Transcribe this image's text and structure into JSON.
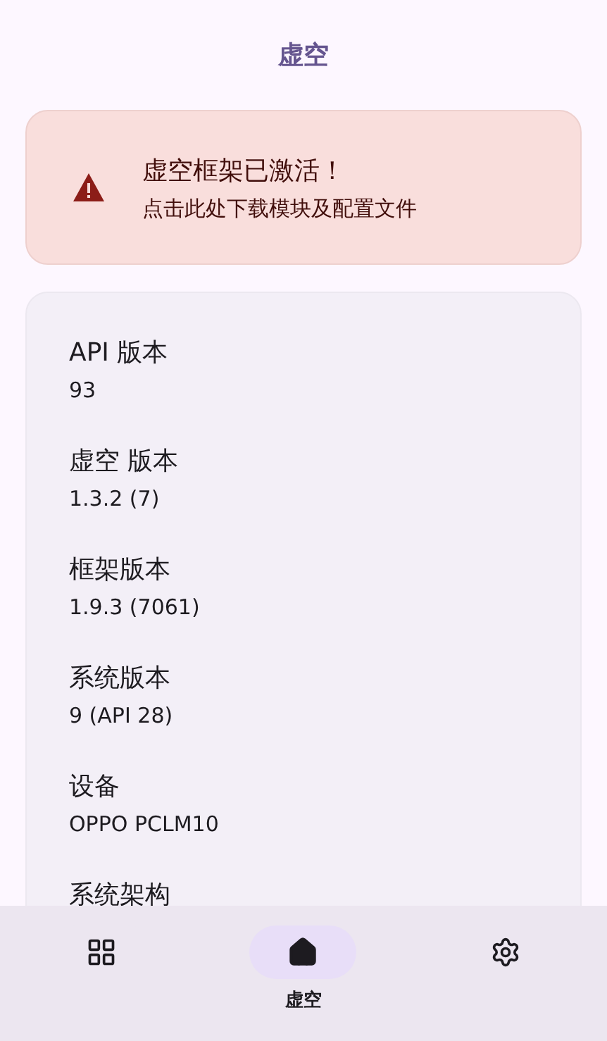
{
  "app_bar": {
    "title": "虚空"
  },
  "status_card": {
    "title": "虚空框架已激活！",
    "subtitle": "点击此处下载模块及配置文件"
  },
  "info": [
    {
      "label": "API 版本",
      "value": "93"
    },
    {
      "label": "虚空 版本",
      "value": "1.3.2 (7)"
    },
    {
      "label": "框架版本",
      "value": "1.9.3 (7061)"
    },
    {
      "label": "系统版本",
      "value": "9 (API 28)"
    },
    {
      "label": "设备",
      "value": "OPPO PCLM10"
    },
    {
      "label": "系统架构"
    }
  ],
  "nav": [
    {
      "kind": "modules",
      "selected": false
    },
    {
      "kind": "home",
      "label": "虚空",
      "selected": true
    },
    {
      "kind": "settings",
      "selected": false
    }
  ]
}
